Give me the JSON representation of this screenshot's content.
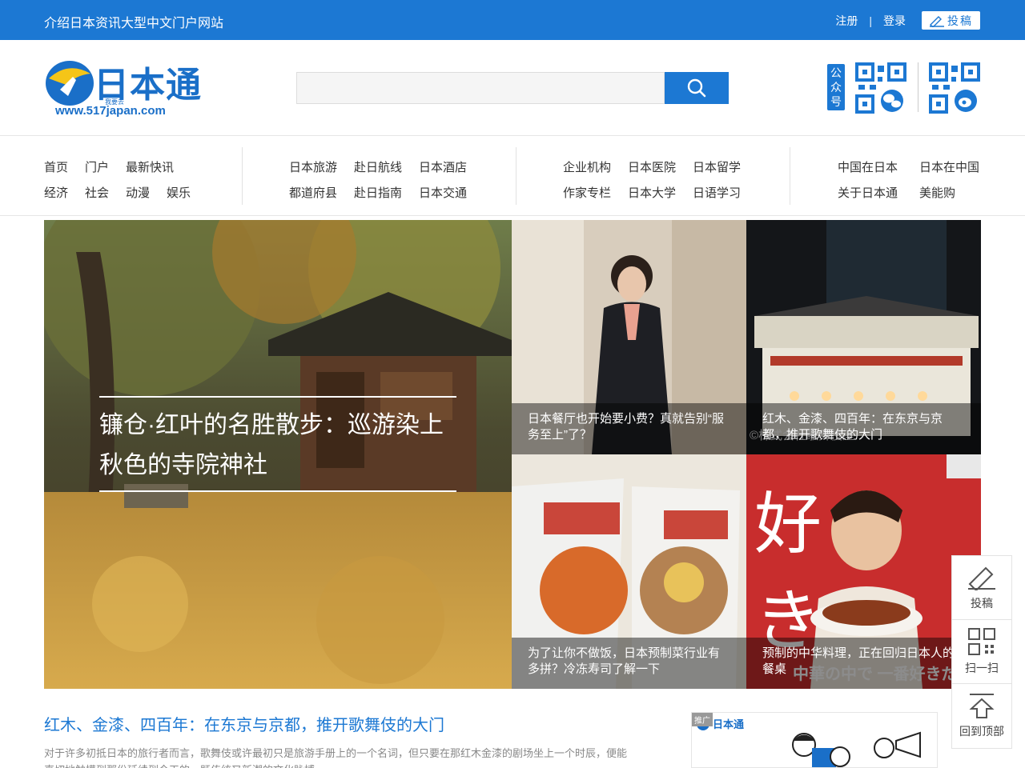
{
  "topbar": {
    "tagline": "介绍日本资讯大型中文门户网站",
    "register": "注册",
    "separator": "|",
    "login": "登录",
    "contribute": "投稿"
  },
  "header": {
    "logo_brand": "日本通",
    "logo_sub": "我要去",
    "logo_url": "www.517japan.com",
    "search_placeholder": "",
    "gongzhonghao": "公众号"
  },
  "nav": {
    "group1": {
      "row1": [
        "首页",
        "门户",
        "最新快讯"
      ],
      "row2": [
        "经济",
        "社会",
        "动漫",
        "娱乐"
      ]
    },
    "group2": {
      "row1": [
        "日本旅游",
        "赴日航线",
        "日本酒店"
      ],
      "row2": [
        "都道府县",
        "赴日指南",
        "日本交通"
      ]
    },
    "group3": {
      "row1": [
        "企业机构",
        "日本医院",
        "日本留学"
      ],
      "row2": [
        "作家专栏",
        "日本大学",
        "日语学习"
      ]
    },
    "group4": {
      "row1": [
        "中国在日本",
        "日本在中国"
      ],
      "row2": [
        "关于日本通",
        "美能购"
      ]
    }
  },
  "banner": {
    "main_title": "镰仓·红叶的名胜散步：巡游染上秋色的寺院神社",
    "tile1": "日本餐厅也开始要小费？真就告别“服务至上”了？",
    "tile2": "红木、金漆、四百年：在东京与京都，推开歌舞伎的大门",
    "tile2_watermark": "©株式会社歌舞伎座",
    "tile3": "为了让你不做饭，日本预制菜行业有多拼？冷冻寿司了解一下",
    "tile4": "预制的中华料理，正在回归日本人的餐桌",
    "tile4_text_big": "好き",
    "tile4_text_jp": "中華の中で 一番好きだっ!"
  },
  "article": {
    "title": "红木、金漆、四百年：在东京与京都，推开歌舞伎的大门",
    "summary": "对于许多初抵日本的旅行者而言，歌舞伎或许最初只是旅游手册上的一个名词，但只要在那红木金漆的剧场坐上一个时辰，便能真切地触摸到那份延续到今天的，既传统又新潮的文化脉搏。"
  },
  "promo": {
    "ad_label": "推广"
  },
  "floatbar": {
    "contribute": "投稿",
    "scan": "扫一扫",
    "top": "回到顶部"
  }
}
